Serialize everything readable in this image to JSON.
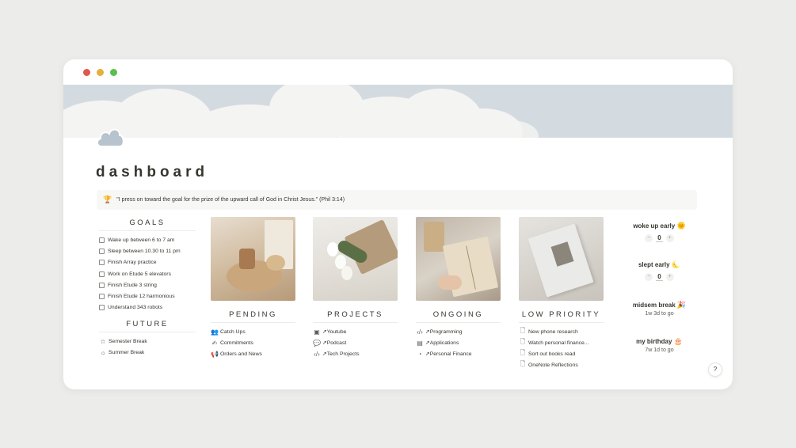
{
  "page": {
    "title": "dashboard",
    "icon": "cloud-icon"
  },
  "callout": {
    "emoji": "🏆",
    "text": "\"I press on toward the goal for the prize of the upward call of God in Christ Jesus.\" (Phil 3:14)"
  },
  "goals": {
    "heading": "GOALS",
    "items": [
      "Wake up between 6 to 7 am",
      "Sleep between 10.30 to 11 pm",
      "Finish Array practice",
      "Work on Etude 5 elevators",
      "Finish Etude 3 string",
      "Finish Etude 12 harmonious",
      "Understand 343 robots"
    ]
  },
  "future": {
    "heading": "FUTURE",
    "items": [
      {
        "label": "Semester Break",
        "icon": "star-icon"
      },
      {
        "label": "Summer Break",
        "icon": "sun-icon"
      }
    ]
  },
  "columns": [
    {
      "heading": "PENDING",
      "items": [
        {
          "label": "Catch Ups",
          "icon": "people-icon"
        },
        {
          "label": "Commitments",
          "icon": "handshake-icon"
        },
        {
          "label": "Orders and News",
          "icon": "megaphone-icon"
        }
      ]
    },
    {
      "heading": "PROJECTS",
      "items": [
        {
          "label": "↗Youtube",
          "icon": "video-icon"
        },
        {
          "label": "↗Podcast",
          "icon": "chat-icon"
        },
        {
          "label": "↗Tech Projects",
          "icon": "code-icon"
        }
      ]
    },
    {
      "heading": "ONGOING",
      "items": [
        {
          "label": "↗Programming",
          "icon": "code-icon"
        },
        {
          "label": "↗Applications",
          "icon": "building-icon"
        },
        {
          "label": "↗Personal Finance",
          "icon": "piggy-bank-icon"
        }
      ]
    },
    {
      "heading": "LOW PRIORITY",
      "items": [
        {
          "label": "New phone research",
          "icon": "page-icon"
        },
        {
          "label": "Watch personal finance...",
          "icon": "page-icon"
        },
        {
          "label": "Sort out books read",
          "icon": "page-icon"
        },
        {
          "label": "OneNote Reflections",
          "icon": "page-icon"
        }
      ]
    }
  ],
  "widgets": {
    "woke_up": {
      "title": "woke up early",
      "emoji": "🌞",
      "value": "0",
      "minus": "−",
      "plus": "+"
    },
    "slept": {
      "title": "slept early",
      "emoji": "🌜",
      "value": "0",
      "minus": "−",
      "plus": "+"
    },
    "midsem": {
      "title": "midsem break",
      "emoji": "🎉",
      "countdown": "1w 3d to go"
    },
    "birthday": {
      "title": "my birthday",
      "emoji": "🎂",
      "countdown": "7w 1d to go"
    }
  },
  "help": {
    "label": "?"
  },
  "colors": {
    "background": "#ececea",
    "text": "#37352f",
    "cover_sky": "#d4dbe0",
    "close": "#e0574c",
    "minimize": "#e3b13c",
    "maximize": "#5bbf4e"
  }
}
